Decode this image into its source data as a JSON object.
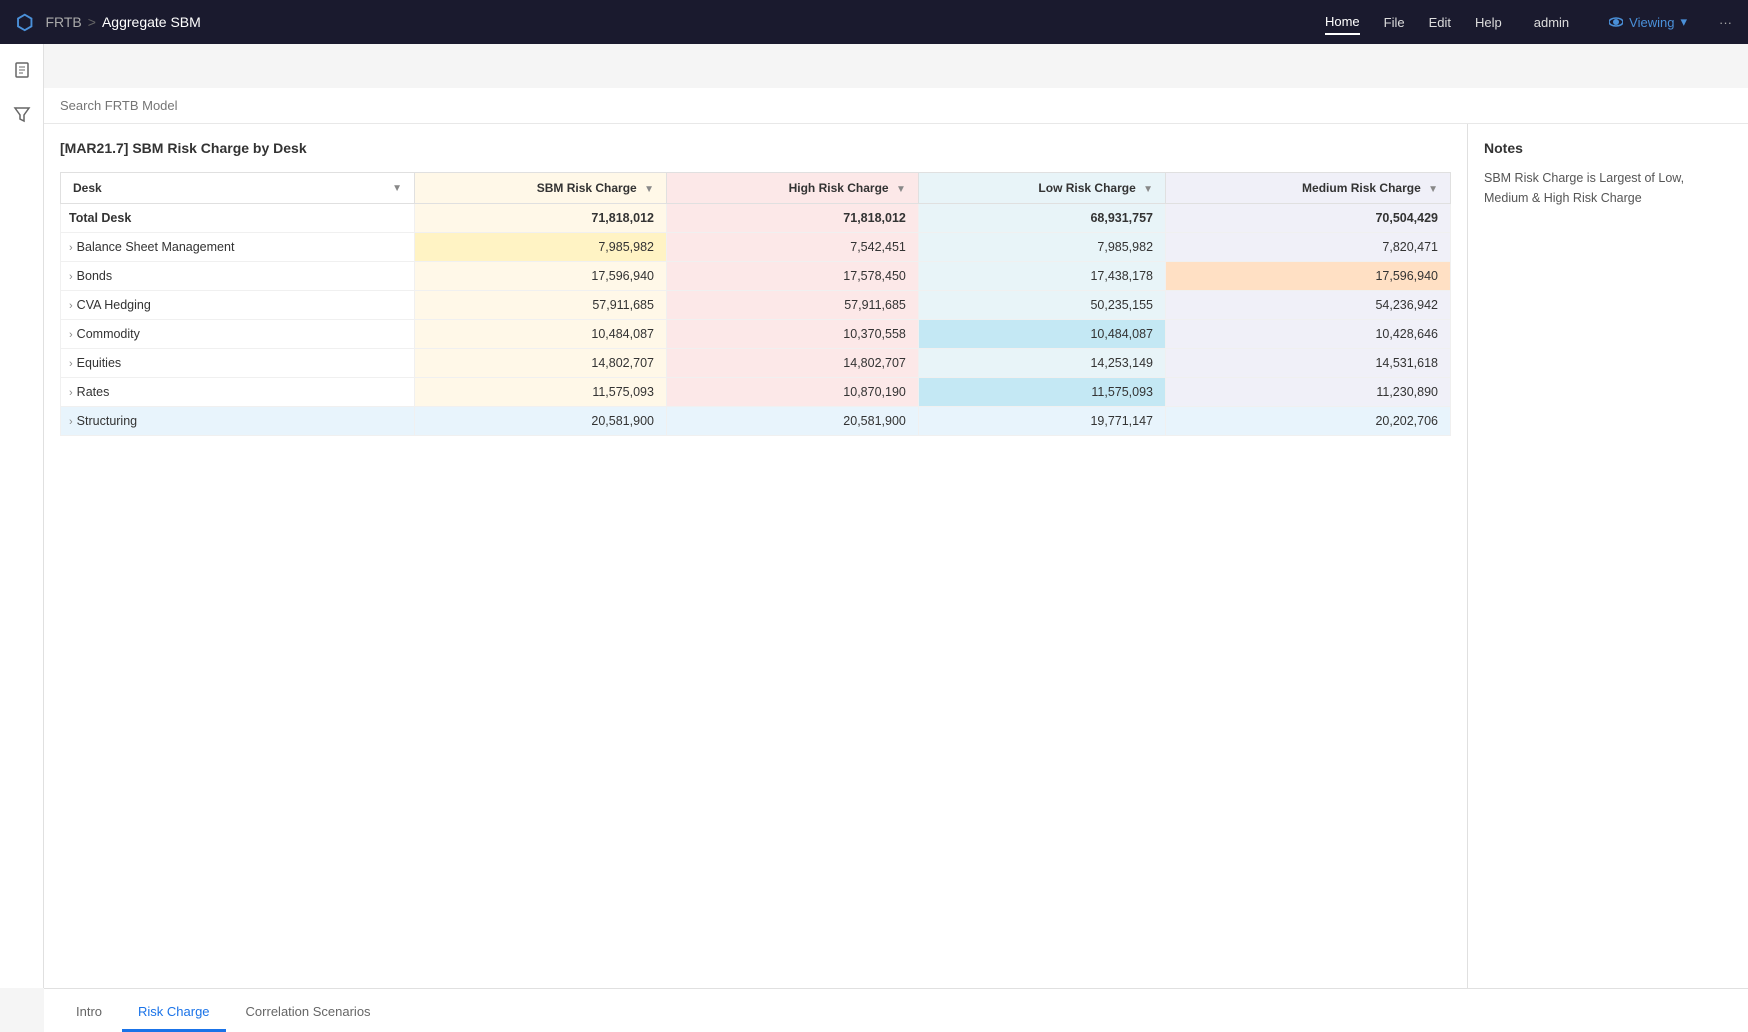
{
  "nav": {
    "logo": "⬡",
    "app": "FRTB",
    "separator": ">",
    "page": "Aggregate SBM",
    "menu_items": [
      "Home",
      "File",
      "Edit",
      "Help"
    ],
    "active_menu": "Home",
    "user": "admin",
    "viewing_label": "Viewing"
  },
  "search": {
    "placeholder": "Search FRTB Model"
  },
  "content": {
    "title": "[MAR21.7] SBM Risk Charge by Desk",
    "columns": {
      "desk": "Desk",
      "sbm": "SBM Risk Charge",
      "high": "High Risk Charge",
      "low": "Low Risk Charge",
      "medium": "Medium Risk Charge"
    },
    "rows": [
      {
        "name": "Total Desk",
        "is_total": true,
        "expandable": false,
        "sbm": "71,818,012",
        "high": "71,818,012",
        "low": "68,931,757",
        "medium": "70,504,429",
        "highlight_sbm": false,
        "highlight_high": false,
        "highlight_low": false,
        "highlight_medium": false
      },
      {
        "name": "Balance Sheet Management",
        "is_total": false,
        "expandable": true,
        "sbm": "7,985,982",
        "high": "7,542,451",
        "low": "7,985,982",
        "medium": "7,820,471",
        "highlight_sbm": true,
        "highlight_high": false,
        "highlight_low": false,
        "highlight_medium": false
      },
      {
        "name": "Bonds",
        "is_total": false,
        "expandable": true,
        "sbm": "17,596,940",
        "high": "17,578,450",
        "low": "17,438,178",
        "medium": "17,596,940",
        "highlight_sbm": false,
        "highlight_high": false,
        "highlight_low": false,
        "highlight_medium": true
      },
      {
        "name": "CVA Hedging",
        "is_total": false,
        "expandable": true,
        "sbm": "57,911,685",
        "high": "57,911,685",
        "low": "50,235,155",
        "medium": "54,236,942",
        "highlight_sbm": false,
        "highlight_high": false,
        "highlight_low": false,
        "highlight_medium": false
      },
      {
        "name": "Commodity",
        "is_total": false,
        "expandable": true,
        "sbm": "10,484,087",
        "high": "10,370,558",
        "low": "10,484,087",
        "medium": "10,428,646",
        "highlight_sbm": false,
        "highlight_high": false,
        "highlight_low": true,
        "highlight_medium": false
      },
      {
        "name": "Equities",
        "is_total": false,
        "expandable": true,
        "sbm": "14,802,707",
        "high": "14,802,707",
        "low": "14,253,149",
        "medium": "14,531,618",
        "highlight_sbm": false,
        "highlight_high": false,
        "highlight_low": false,
        "highlight_medium": false
      },
      {
        "name": "Rates",
        "is_total": false,
        "expandable": true,
        "sbm": "11,575,093",
        "high": "10,870,190",
        "low": "11,575,093",
        "medium": "11,230,890",
        "highlight_sbm": false,
        "highlight_high": false,
        "highlight_low": true,
        "highlight_medium": false
      },
      {
        "name": "Structuring",
        "is_total": false,
        "expandable": true,
        "selected": true,
        "sbm": "20,581,900",
        "high": "20,581,900",
        "low": "19,771,147",
        "medium": "20,202,706",
        "highlight_sbm": false,
        "highlight_high": false,
        "highlight_low": false,
        "highlight_medium": false
      }
    ]
  },
  "notes": {
    "title": "Notes",
    "content": "SBM Risk Charge is Largest of Low, Medium & High Risk Charge"
  },
  "tabs": [
    {
      "label": "Intro",
      "active": false
    },
    {
      "label": "Risk Charge",
      "active": true
    },
    {
      "label": "Correlation Scenarios",
      "active": false
    }
  ]
}
